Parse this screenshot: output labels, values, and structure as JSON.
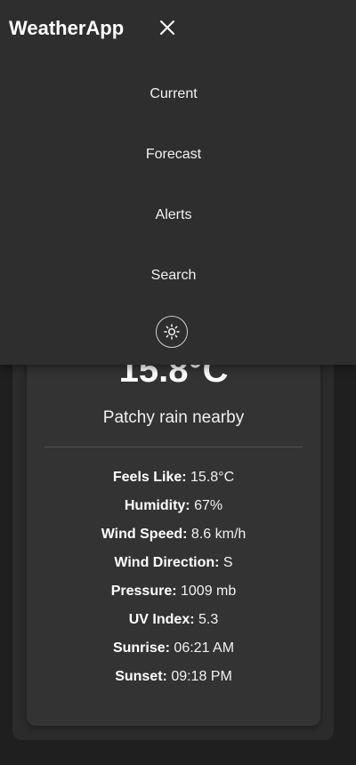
{
  "header": {
    "app_title": "WeatherApp"
  },
  "nav": {
    "items": [
      {
        "label": "Current"
      },
      {
        "label": "Forecast"
      },
      {
        "label": "Alerts"
      },
      {
        "label": "Search"
      }
    ],
    "theme_toggle_icon": "sun-icon",
    "close_icon": "close-icon"
  },
  "current": {
    "temperature": "15.8°C",
    "condition": "Patchy rain nearby",
    "details": [
      {
        "label": "Feels Like:",
        "value": "15.8°C"
      },
      {
        "label": "Humidity:",
        "value": "67%"
      },
      {
        "label": "Wind Speed:",
        "value": "8.6 km/h"
      },
      {
        "label": "Wind Direction:",
        "value": "S"
      },
      {
        "label": "Pressure:",
        "value": "1009 mb"
      },
      {
        "label": "UV Index:",
        "value": "5.3"
      },
      {
        "label": "Sunrise:",
        "value": "06:21 AM"
      },
      {
        "label": "Sunset:",
        "value": "09:18 PM"
      }
    ]
  },
  "colors": {
    "background": "#1f1f1f",
    "panel": "#2e2e2e",
    "card": "#333333",
    "text": "#ffffff"
  }
}
